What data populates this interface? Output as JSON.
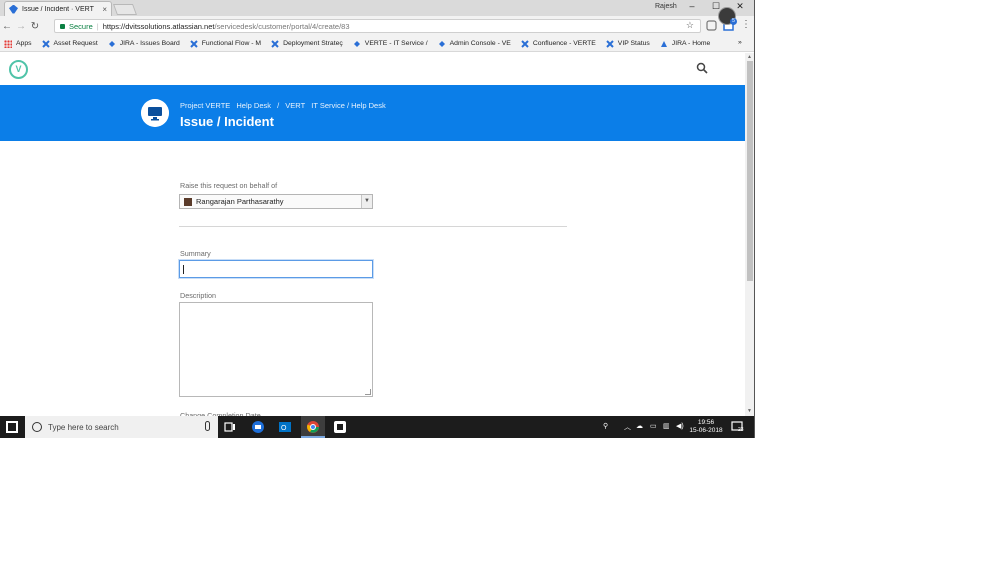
{
  "browser": {
    "tab_title": "Issue / Incident · VERT",
    "tab_close": "×",
    "user_name": "Rajesh",
    "window_controls": [
      "–",
      "☐",
      "✕"
    ],
    "url_secure_label": "Secure",
    "url_host": "https://dvitssolutions.atlassian.net",
    "url_path": "/servicedesk/customer/portal/4/create/83",
    "star_icon": "☆",
    "menu_icon": "⋮"
  },
  "bookmarks": {
    "apps_label": "Apps",
    "items": [
      "Asset Request",
      "JIRA - Issues Board",
      "Functional Flow - M",
      "Deployment Strateç",
      "VERTE - IT Service /",
      "Admin Console - VE",
      "Confluence - VERTE",
      "VIP Status",
      "JIRA - Home"
    ],
    "overflow": "»"
  },
  "header": {
    "logo_glyph": "V",
    "avatar_badge": "5"
  },
  "banner": {
    "breadcrumbs": [
      "Project VERTE",
      "Help Desk",
      "/",
      "VERT",
      "IT Service / Help Desk"
    ],
    "title": "Issue / Incident"
  },
  "form": {
    "on_behalf_label": "Raise this request on behalf of",
    "on_behalf_value": "Rangarajan Parthasarathy",
    "summary_label": "Summary",
    "summary_value": "",
    "description_label": "Description",
    "next_label": "Change Completion Date"
  },
  "taskbar": {
    "search_placeholder": "Type here to search",
    "time": "19:56",
    "date": "15-06-2018",
    "notifications": "23"
  },
  "colors": {
    "banner": "#0b7ee8",
    "logo": "#4fc3a8",
    "taskbar": "#1c1c1c"
  }
}
